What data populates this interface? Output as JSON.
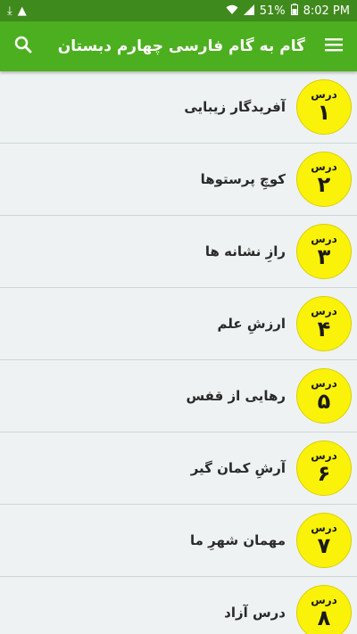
{
  "status_bar": {
    "battery": "51%",
    "time": "8:02 PM"
  },
  "app_bar": {
    "title": "گام به گام فارسی چهارم دبستان",
    "menu_icon": "hamburger-menu-icon",
    "search_icon": "search-icon"
  },
  "lessons": [
    {
      "badge_label": "درس",
      "number": "۱",
      "title": "آفریدگار زیبایی"
    },
    {
      "badge_label": "درس",
      "number": "۲",
      "title": "کوچِ پرستوها"
    },
    {
      "badge_label": "درس",
      "number": "۳",
      "title": "رازِ نشانه ها"
    },
    {
      "badge_label": "درس",
      "number": "۴",
      "title": "ارزشِ علم"
    },
    {
      "badge_label": "درس",
      "number": "۵",
      "title": "رهایی از قفس"
    },
    {
      "badge_label": "درس",
      "number": "۶",
      "title": "آرشِ کمان گیر"
    },
    {
      "badge_label": "درس",
      "number": "۷",
      "title": "مهمان شهرِ ما"
    },
    {
      "badge_label": "درس",
      "number": "۸",
      "title": "درس آزاد"
    }
  ],
  "colors": {
    "app_bar": "#4caf1f",
    "status_bar": "#3f8a1c",
    "badge": "#fbf20a",
    "background": "#eef2f3"
  }
}
